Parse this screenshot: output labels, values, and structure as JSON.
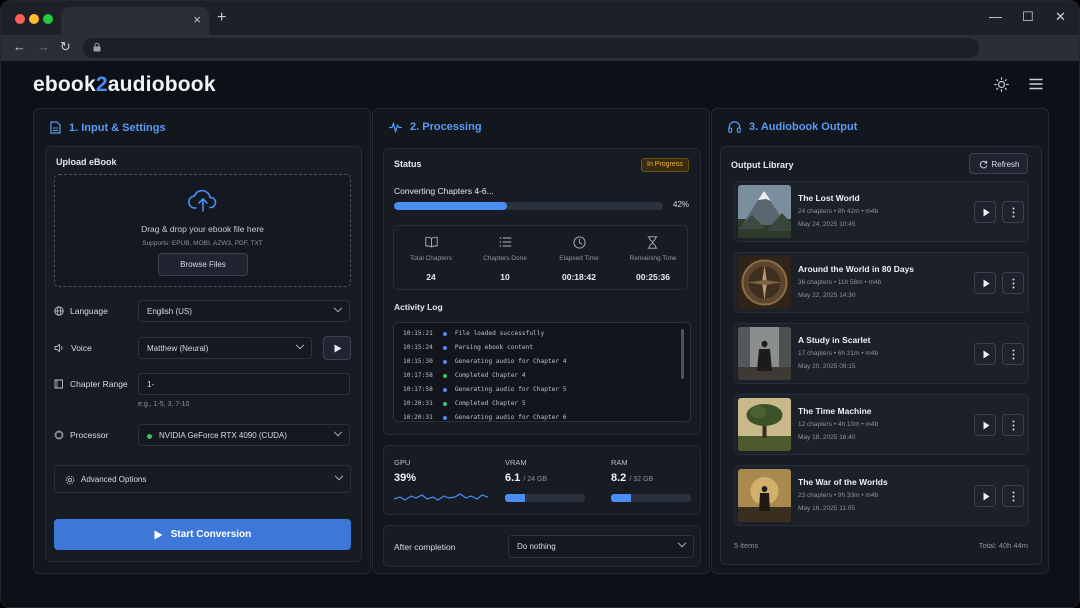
{
  "browser": {
    "tab_close": "×",
    "new_tab": "+",
    "window_controls": {
      "minimize": "—",
      "maximize": "☐",
      "close": "✕"
    },
    "nav": {
      "back": "←",
      "forward": "→",
      "reload": "↻"
    },
    "traffic_lights": [
      "#ff5f57",
      "#febc2e",
      "#28c840"
    ]
  },
  "app": {
    "logo_left": "ebook",
    "logo_num": "2",
    "logo_right": "audiobook",
    "accent": "#4b8df2"
  },
  "input": {
    "title": "1. Input & Settings",
    "upload_title": "Upload eBook",
    "drop_text": "Drag & drop your ebook file here",
    "supports": "Supports: EPUB, MOBI, AZW3, PDF, TXT",
    "browse": "Browse Files",
    "language_label": "Language",
    "language_value": "English (US)",
    "voice_label": "Voice",
    "voice_value": "Matthew (Neural)",
    "chapter_label": "Chapter Range",
    "chapter_value": "1-",
    "chapter_hint": "e.g., 1-5, 3, 7-10",
    "processor_label": "Processor",
    "processor_value": "NVIDIA GeForce RTX 4090 (CUDA)",
    "advanced": "Advanced Options",
    "start": "Start Conversion"
  },
  "processing": {
    "title": "2. Processing",
    "status_label": "Status",
    "status_badge": "In Progress",
    "converting": "Converting Chapters 4-6...",
    "progress_percent": 42,
    "progress_label": "42%",
    "stats": [
      {
        "label": "Total Chapters",
        "value": "24"
      },
      {
        "label": "Chapters Done",
        "value": "10"
      },
      {
        "label": "Elapsed Time",
        "value": "00:18:42"
      },
      {
        "label": "Remaining Time",
        "value": "00:25:36"
      }
    ],
    "log_title": "Activity Log",
    "log": [
      {
        "time": "10:15:21",
        "msg": "File loaded successfully",
        "color": "#4b8df2"
      },
      {
        "time": "10:15:24",
        "msg": "Parsing ebook content",
        "color": "#4b8df2"
      },
      {
        "time": "10:15:30",
        "msg": "Generating audio for Chapter 4",
        "color": "#4b8df2"
      },
      {
        "time": "10:17:58",
        "msg": "Completed Chapter 4",
        "color": "#3cc46a"
      },
      {
        "time": "10:17:58",
        "msg": "Generating audio for Chapter 5",
        "color": "#4b8df2"
      },
      {
        "time": "10:20:31",
        "msg": "Completed Chapter 5",
        "color": "#3cc46a"
      },
      {
        "time": "10:20:31",
        "msg": "Generating audio for Chapter 6",
        "color": "#4b8df2"
      }
    ],
    "gpu_label": "GPU",
    "gpu_value": "39%",
    "vram_label": "VRAM",
    "vram_value": "6.1",
    "vram_total": "/ 24 GB",
    "vram_fraction": 0.254,
    "ram_label": "RAM",
    "ram_value": "8.2",
    "ram_total": "/ 32 GB",
    "ram_fraction": 0.256,
    "after_label": "After completion",
    "after_value": "Do nothing"
  },
  "output": {
    "title": "3. Audiobook Output",
    "library_title": "Output Library",
    "refresh": "Refresh",
    "items": [
      {
        "title": "The Lost World",
        "meta": "24 chapters  •  8h 42m  •  m4b",
        "date": "May 24, 2025 10:45"
      },
      {
        "title": "Around the World in 80 Days",
        "meta": "36 chapters  •  11h 58m  •  m4b",
        "date": "May 22, 2025 14:30"
      },
      {
        "title": "A Study in Scarlet",
        "meta": "17 chapters  •  6h 21m  •  m4b",
        "date": "May 20, 2025 09:15"
      },
      {
        "title": "The Time Machine",
        "meta": "12 chapters  •  4h 10m  •  m4b",
        "date": "May 18, 2025 16:40"
      },
      {
        "title": "The War of the Worlds",
        "meta": "23 chapters  •  9h 33m  •  m4b",
        "date": "May 16, 2025 11:05"
      }
    ],
    "count": "5 items",
    "total": "Total: 40h 44m"
  }
}
